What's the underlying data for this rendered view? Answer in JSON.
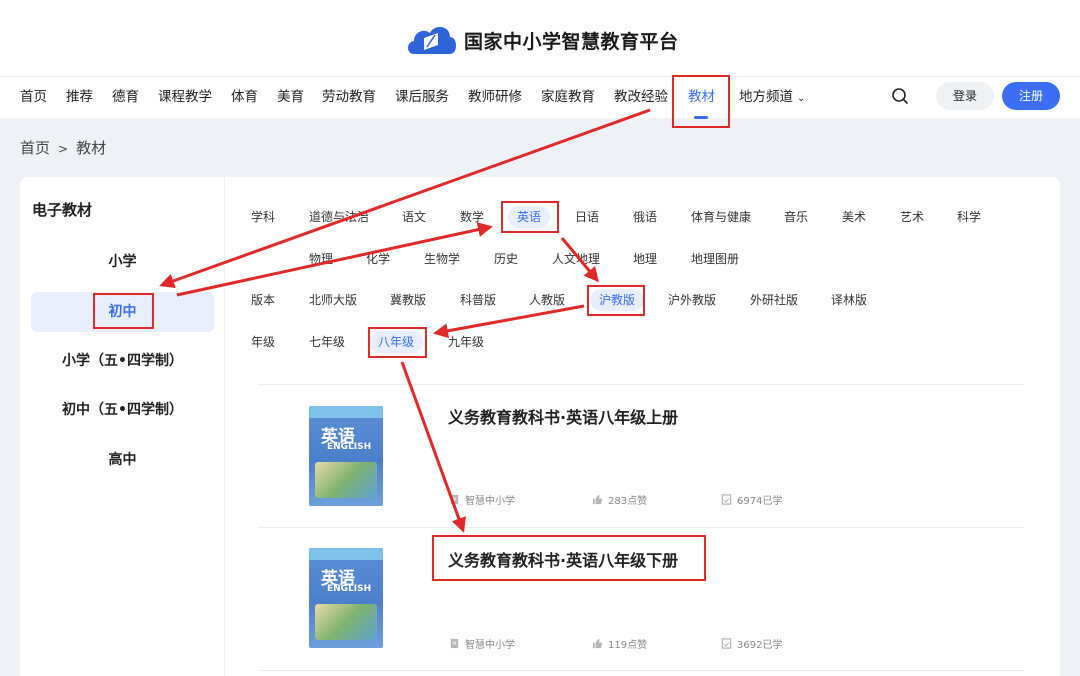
{
  "site": {
    "title": "国家中小学智慧教育平台"
  },
  "nav": {
    "items": [
      "首页",
      "推荐",
      "德育",
      "课程教学",
      "体育",
      "美育",
      "劳动教育",
      "课后服务",
      "教师研修",
      "家庭教育",
      "教改经验",
      "教材",
      "地方频道"
    ],
    "active": "教材",
    "login": "登录",
    "register": "注册"
  },
  "breadcrumb": {
    "home": "首页",
    "sep": ">",
    "current": "教材"
  },
  "sidebar": {
    "title": "电子教材",
    "items": [
      "小学",
      "初中",
      "小学（五•四学制）",
      "初中（五•四学制）",
      "高中"
    ],
    "selected": "初中"
  },
  "filters": {
    "subject_label": "学科",
    "subjects_row1": [
      "道德与法治",
      "语文",
      "数学",
      "英语",
      "日语",
      "俄语",
      "体育与健康",
      "音乐",
      "美术",
      "艺术",
      "科学"
    ],
    "subjects_row2": [
      "物理",
      "化学",
      "生物学",
      "历史",
      "人文地理",
      "地理",
      "地理图册"
    ],
    "edition_label": "版本",
    "editions": [
      "北师大版",
      "冀教版",
      "科普版",
      "人教版",
      "沪教版",
      "沪外教版",
      "外研社版",
      "译林版"
    ],
    "grade_label": "年级",
    "grades": [
      "七年级",
      "八年级",
      "九年级"
    ],
    "selected_subject": "英语",
    "selected_edition": "沪教版",
    "selected_grade": "八年级"
  },
  "books": [
    {
      "title": "义务教育教科书·英语八年级上册",
      "publisher": "智慧中小学",
      "likes": "283点赞",
      "learners": "6974已学",
      "cover_title": "英语",
      "cover_en": "ENGLISH"
    },
    {
      "title": "义务教育教科书·英语八年级下册",
      "publisher": "智慧中小学",
      "likes": "119点赞",
      "learners": "3692已学",
      "cover_title": "英语",
      "cover_en": "ENGLISH"
    }
  ],
  "colors": {
    "accent": "#3b6ef5",
    "annotation": "#e02a2a"
  },
  "icons": [
    "logo-cloud-icon",
    "search-icon",
    "chevron-down-icon",
    "document-icon",
    "thumb-up-icon",
    "learners-icon"
  ]
}
